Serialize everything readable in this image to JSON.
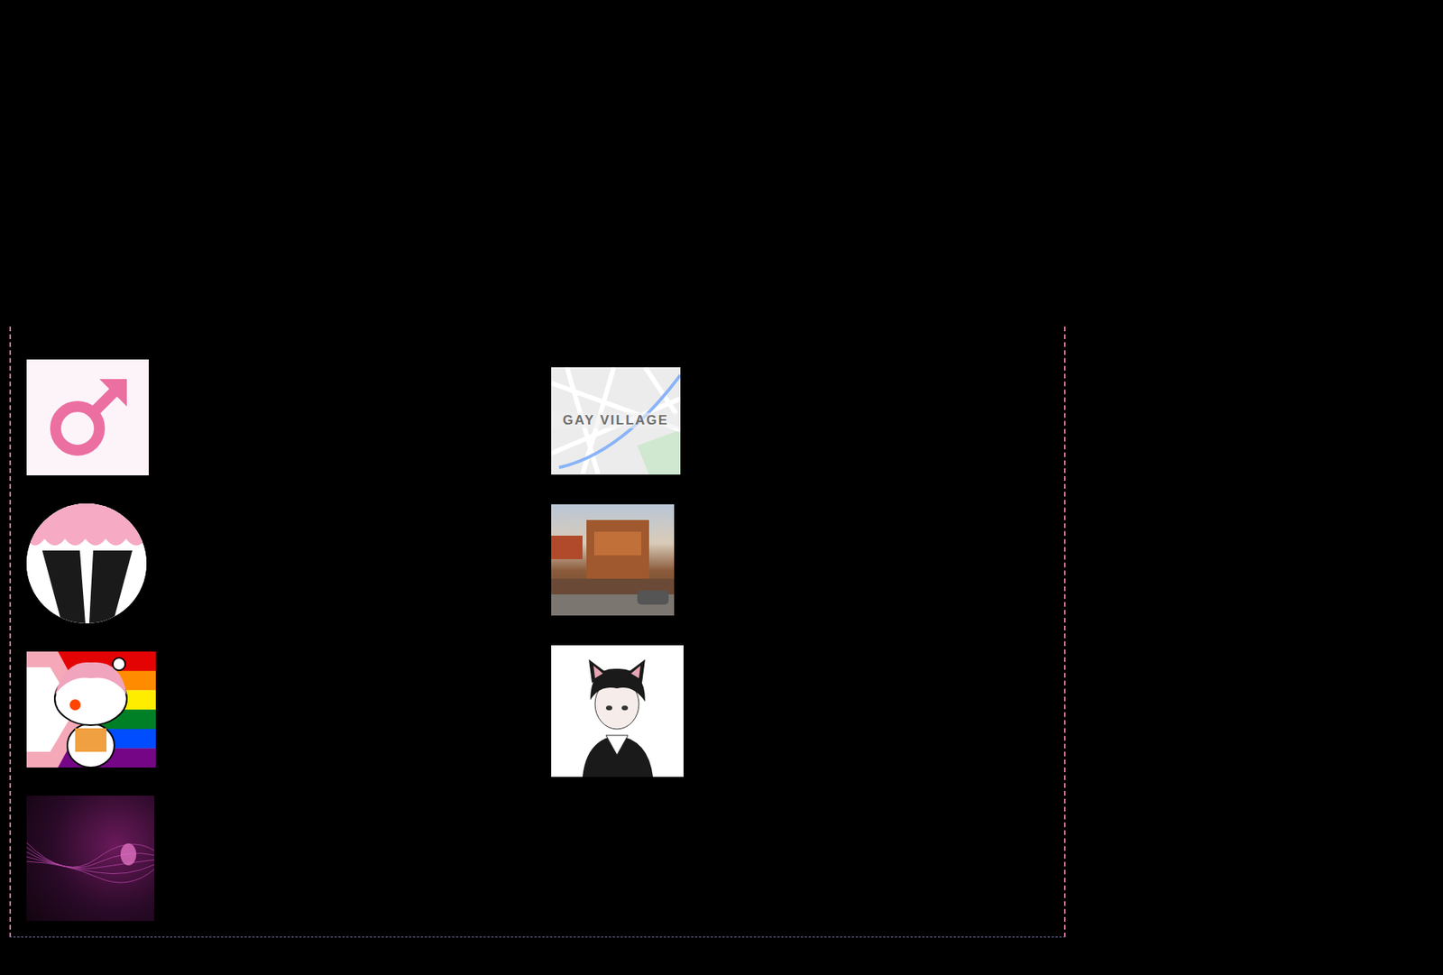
{
  "gallery": {
    "left_column": [
      {
        "kind": "male-symbol"
      },
      {
        "kind": "stockings"
      },
      {
        "kind": "snoo-pride"
      },
      {
        "kind": "purple-abstract"
      }
    ],
    "right_column": [
      {
        "kind": "map",
        "label": "GAY VILLAGE"
      },
      {
        "kind": "restaurant-photo"
      },
      {
        "kind": "catboy-drawing"
      }
    ]
  }
}
